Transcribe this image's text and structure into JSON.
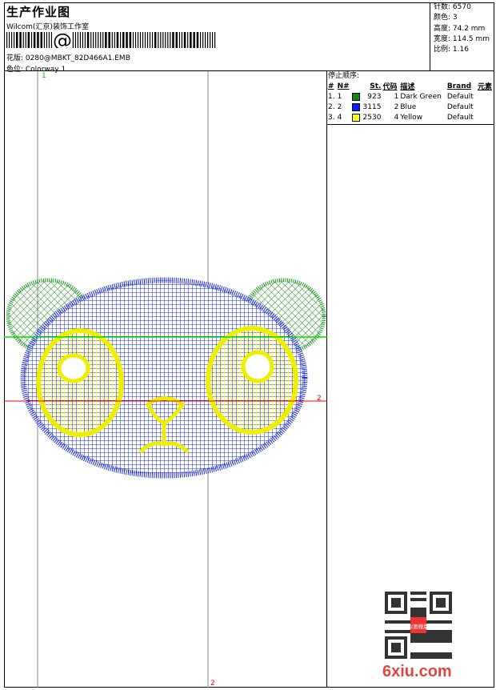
{
  "header": {
    "title": "生产作业图",
    "company": "Wilcom(汇京)装饰工作室",
    "barcode_text": "@",
    "design": "花版: 0280@MBKT_82D466A1.EMB",
    "colorway": "色位: Colorway 1"
  },
  "stats": {
    "stitches": "针数: 6570",
    "colors": "颜色: 3",
    "height": "高度: 74.2 mm",
    "width": "宽度: 114.5 mm",
    "scale": "比例: 1.16"
  },
  "stops": {
    "title": "停止顺序:",
    "columns": [
      "#",
      "N#",
      "St.",
      "代码",
      "描述",
      "Brand",
      "元素"
    ],
    "rows": [
      {
        "idx": "1.",
        "n": "1",
        "color": "#0a8a0a",
        "st": "923",
        "code": "1",
        "desc": "Dark Green",
        "brand": "Default"
      },
      {
        "idx": "2.",
        "n": "2",
        "color": "#0022ff",
        "st": "3115",
        "code": "2",
        "desc": "Blue",
        "brand": "Default"
      },
      {
        "idx": "3.",
        "n": "4",
        "color": "#ffff00",
        "st": "2530",
        "code": "4",
        "desc": "Yellow",
        "brand": "Default"
      }
    ]
  },
  "guides": {
    "v1_label": "1",
    "h2_label": "2",
    "v2_label": "2"
  },
  "watermark": {
    "text": "6xiu.com",
    "seal": "以图搜版"
  }
}
